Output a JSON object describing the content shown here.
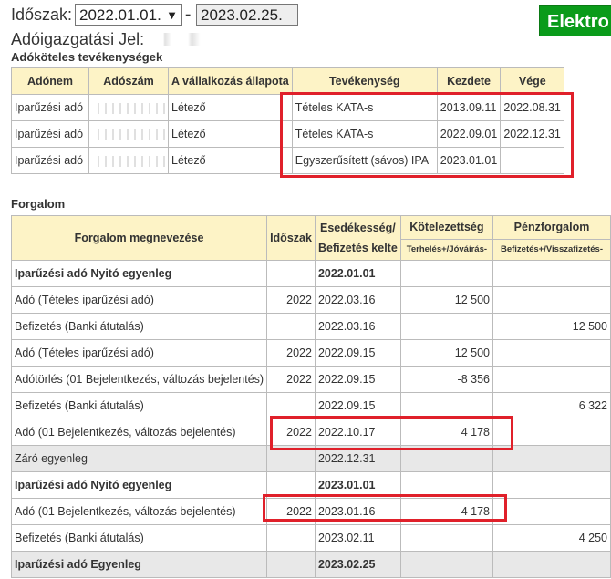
{
  "header": {
    "period_label": "Időszak:",
    "date_from": "2022.01.01.",
    "date_separator": "-",
    "date_to": "2023.02.25.",
    "green_button": "Elektro",
    "tax_authority_label": "Adóigazgatási Jel:"
  },
  "activities": {
    "title": "Adóköteles tevékenységek",
    "columns": [
      "Adónem",
      "Adószám",
      "A vállalkozás állapota",
      "Tevékenység",
      "Kezdete",
      "Vége"
    ],
    "rows": [
      {
        "tax_type": "Iparűzési adó",
        "status": "Létező",
        "activity": "Tételes KATA-s",
        "start": "2013.09.11",
        "end": "2022.08.31"
      },
      {
        "tax_type": "Iparűzési adó",
        "status": "Létező",
        "activity": "Tételes KATA-s",
        "start": "2022.09.01",
        "end": "2022.12.31"
      },
      {
        "tax_type": "Iparűzési adó",
        "status": "Létező",
        "activity": "Egyszerűsített (sávos) IPA",
        "start": "2023.01.01",
        "end": ""
      }
    ]
  },
  "turnover": {
    "title": "Forgalom",
    "columns": {
      "name": "Forgalom megnevezése",
      "period": "Időszak",
      "due_line1": "Esedékesség/",
      "due_line2": "Befizetés kelte",
      "liability": "Kötelezettség",
      "liability_sub": "Terhelés+/Jóváírás-",
      "cash": "Pénzforgalom",
      "cash_sub": "Befizetés+/Visszafizetés-"
    },
    "rows": [
      {
        "name": "Iparűzési adó Nyitó egyenleg",
        "period": "",
        "date": "2022.01.01",
        "liability": "",
        "cash": "",
        "bold": true,
        "grey": false
      },
      {
        "name": "Adó (Tételes iparűzési adó)",
        "period": "2022",
        "date": "2022.03.16",
        "liability": "12 500",
        "cash": "",
        "bold": false,
        "grey": false
      },
      {
        "name": "Befizetés (Banki átutalás)",
        "period": "",
        "date": "2022.03.16",
        "liability": "",
        "cash": "12 500",
        "bold": false,
        "grey": false
      },
      {
        "name": "Adó (Tételes iparűzési adó)",
        "period": "2022",
        "date": "2022.09.15",
        "liability": "12 500",
        "cash": "",
        "bold": false,
        "grey": false
      },
      {
        "name": "Adótörlés (01 Bejelentkezés, változás bejelentés)",
        "period": "2022",
        "date": "2022.09.15",
        "liability": "-8 356",
        "cash": "",
        "bold": false,
        "grey": false
      },
      {
        "name": "Befizetés (Banki átutalás)",
        "period": "",
        "date": "2022.09.15",
        "liability": "",
        "cash": "6 322",
        "bold": false,
        "grey": false
      },
      {
        "name": "Adó (01 Bejelentkezés, változás bejelentés)",
        "period": "2022",
        "date": "2022.10.17",
        "liability": "4 178",
        "cash": "",
        "bold": false,
        "grey": false
      },
      {
        "name": "Záró egyenleg",
        "period": "",
        "date": "2022.12.31",
        "liability": "",
        "cash": "",
        "bold": false,
        "grey": true
      },
      {
        "name": "Iparűzési adó Nyitó egyenleg",
        "period": "",
        "date": "2023.01.01",
        "liability": "",
        "cash": "",
        "bold": true,
        "grey": false
      },
      {
        "name": "Adó (01 Bejelentkezés, változás bejelentés)",
        "period": "2022",
        "date": "2023.01.16",
        "liability": "4 178",
        "cash": "",
        "bold": false,
        "grey": false
      },
      {
        "name": "Befizetés (Banki átutalás)",
        "period": "",
        "date": "2023.02.11",
        "liability": "",
        "cash": "4 250",
        "bold": false,
        "grey": false
      },
      {
        "name": "Iparűzési adó Egyenleg",
        "period": "",
        "date": "2023.02.25",
        "liability": "",
        "cash": "",
        "bold": true,
        "grey": true
      }
    ]
  },
  "colors": {
    "highlight": "#e0202a",
    "header_bg": "#fdf3c6",
    "button_green": "#0a9b1a",
    "grey_row": "#e8e8e8"
  }
}
